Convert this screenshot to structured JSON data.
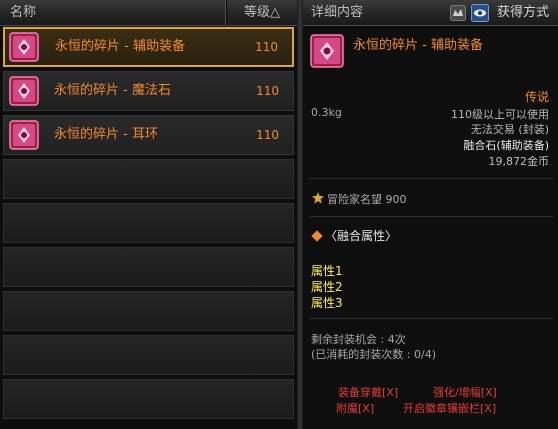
{
  "list_header": {
    "name": "名称",
    "level": "等级△"
  },
  "items": [
    {
      "name": "永恒的碎片 - 辅助装备",
      "level": "110",
      "selected": true
    },
    {
      "name": "永恒的碎片 - 魔法石",
      "level": "110"
    },
    {
      "name": "永恒的碎片 - 耳环",
      "level": "110"
    }
  ],
  "detail_header": {
    "title": "详细内容",
    "acquire_label": "获得方式"
  },
  "detail": {
    "name": "永恒的碎片 - 辅助装备",
    "rarity": "传说",
    "weight": "0.3kg",
    "req_level": "110级以上可以使用",
    "trade": "无法交易 (封装)",
    "fusion_type": "融合石(辅助装备)",
    "price": "19,872金币",
    "reputation": "冒险家名望 900",
    "fusion_title": "〈融合属性〉",
    "attributes": [
      "属性1",
      "属性2",
      "属性3"
    ],
    "seal_remaining": "剩余封装机会 : 4次",
    "seal_used": "(已消耗的封装次数 : 0/4)"
  },
  "actions": {
    "equip": "装备穿戴[X]",
    "enhance": "强化/增幅[X]",
    "enchant": "附魔[X]",
    "emblem": "开启徽章镶嵌栏[X]"
  },
  "colors": {
    "orange": "#f08a2c",
    "yellow": "#ffee55",
    "red": "#e53a3a",
    "gold_border": "#d9a73a"
  }
}
